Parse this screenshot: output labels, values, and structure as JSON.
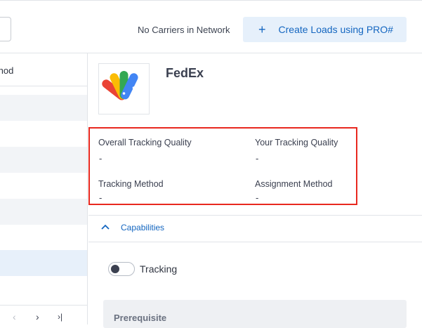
{
  "header": {
    "carrier_status": "No Carriers in Network",
    "create_button": {
      "icon": "plus-icon",
      "label": "Create Loads using PRO#"
    }
  },
  "left_list": {
    "column_header": "thod",
    "pager": {
      "prev": "‹",
      "next": "›",
      "last": "›|"
    }
  },
  "carrier": {
    "name": "FedEx",
    "logo": "carrier-logo"
  },
  "tracking": {
    "overall_quality_label": "Overall Tracking Quality",
    "overall_quality_value": "-",
    "your_quality_label": "Your Tracking Quality",
    "your_quality_value": "-",
    "method_label": "Tracking Method",
    "method_value": "-",
    "assignment_label": "Assignment Method",
    "assignment_value": "-"
  },
  "capabilities": {
    "label": "Capabilities",
    "expanded": true,
    "toggle_label": "Tracking",
    "toggle_on": false,
    "prerequisite_label": "Prerequisite"
  },
  "colors": {
    "accent": "#1466c0",
    "button_bg": "#e6f0fb",
    "highlight_border": "#e8281f",
    "selected_row": "#e7f0fa"
  }
}
